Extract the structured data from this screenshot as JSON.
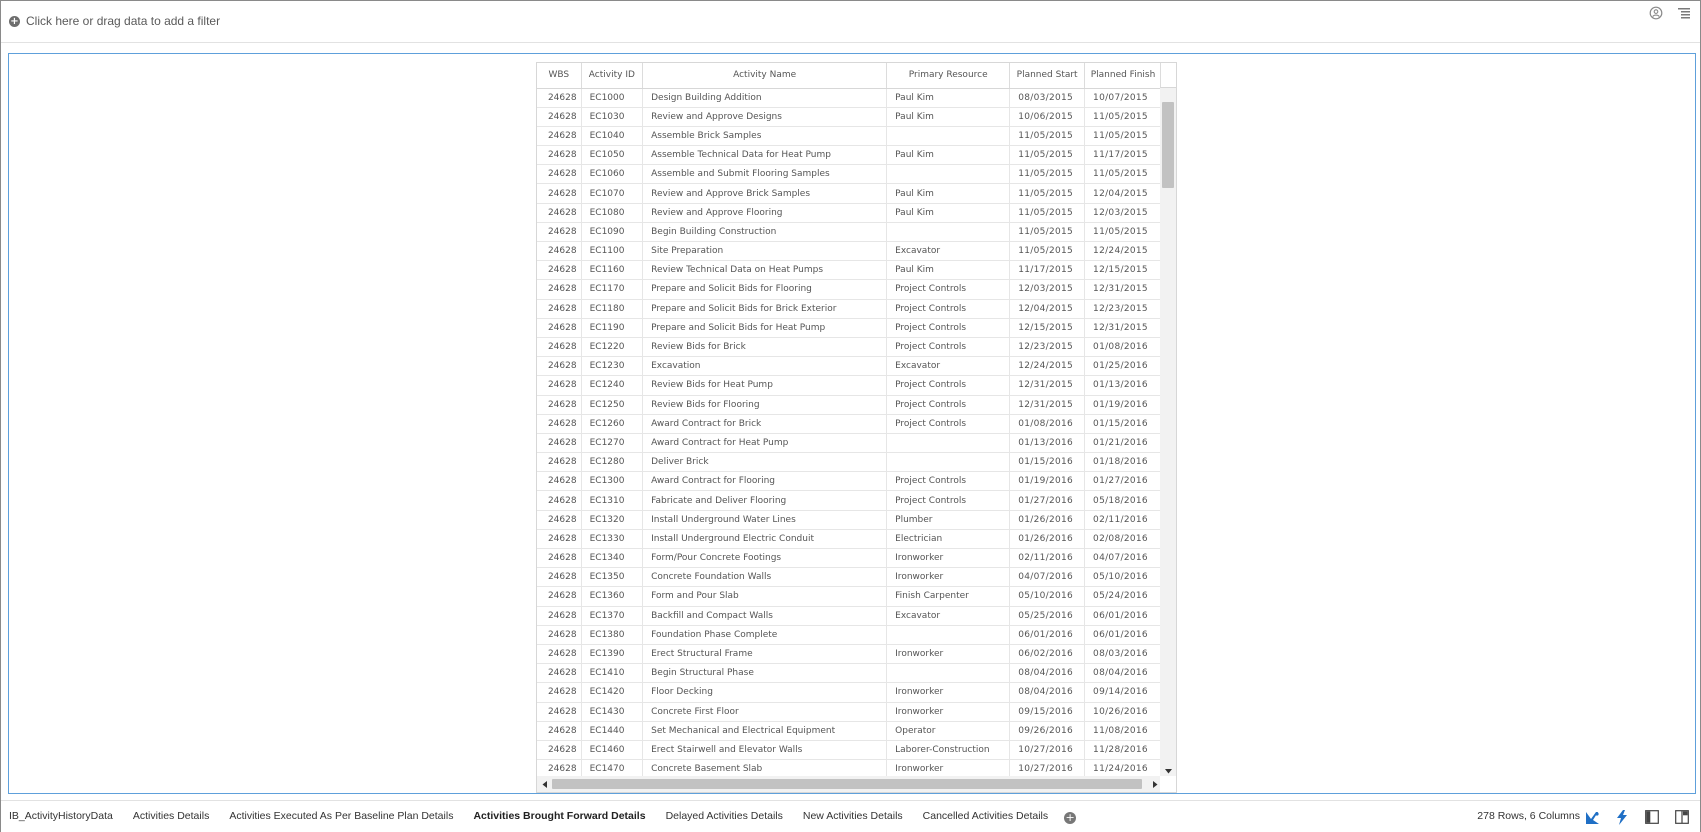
{
  "filter_bar": {
    "add_filter_text": "Click here or drag data to add a filter"
  },
  "table": {
    "columns": [
      "WBS",
      "Activity ID",
      "Activity Name",
      "Primary Resource",
      "Planned Start",
      "Planned Finish"
    ],
    "rows": [
      [
        "24628",
        "EC1000",
        "Design Building Addition",
        "Paul Kim",
        "08/03/2015",
        "10/07/2015"
      ],
      [
        "24628",
        "EC1030",
        "Review and Approve Designs",
        "Paul Kim",
        "10/06/2015",
        "11/05/2015"
      ],
      [
        "24628",
        "EC1040",
        "Assemble Brick Samples",
        "",
        "11/05/2015",
        "11/05/2015"
      ],
      [
        "24628",
        "EC1050",
        "Assemble Technical Data for Heat Pump",
        "Paul Kim",
        "11/05/2015",
        "11/17/2015"
      ],
      [
        "24628",
        "EC1060",
        "Assemble and Submit Flooring Samples",
        "",
        "11/05/2015",
        "11/05/2015"
      ],
      [
        "24628",
        "EC1070",
        "Review and Approve Brick Samples",
        "Paul Kim",
        "11/05/2015",
        "12/04/2015"
      ],
      [
        "24628",
        "EC1080",
        "Review and Approve Flooring",
        "Paul Kim",
        "11/05/2015",
        "12/03/2015"
      ],
      [
        "24628",
        "EC1090",
        "Begin Building Construction",
        "",
        "11/05/2015",
        "11/05/2015"
      ],
      [
        "24628",
        "EC1100",
        "Site Preparation",
        "Excavator",
        "11/05/2015",
        "12/24/2015"
      ],
      [
        "24628",
        "EC1160",
        "Review Technical Data on Heat Pumps",
        "Paul Kim",
        "11/17/2015",
        "12/15/2015"
      ],
      [
        "24628",
        "EC1170",
        "Prepare and Solicit Bids for Flooring",
        "Project Controls",
        "12/03/2015",
        "12/31/2015"
      ],
      [
        "24628",
        "EC1180",
        "Prepare and Solicit Bids for Brick Exterior",
        "Project Controls",
        "12/04/2015",
        "12/23/2015"
      ],
      [
        "24628",
        "EC1190",
        "Prepare and Solicit Bids for Heat Pump",
        "Project Controls",
        "12/15/2015",
        "12/31/2015"
      ],
      [
        "24628",
        "EC1220",
        "Review Bids for Brick",
        "Project Controls",
        "12/23/2015",
        "01/08/2016"
      ],
      [
        "24628",
        "EC1230",
        "Excavation",
        "Excavator",
        "12/24/2015",
        "01/25/2016"
      ],
      [
        "24628",
        "EC1240",
        "Review Bids for Heat Pump",
        "Project Controls",
        "12/31/2015",
        "01/13/2016"
      ],
      [
        "24628",
        "EC1250",
        "Review Bids for Flooring",
        "Project Controls",
        "12/31/2015",
        "01/19/2016"
      ],
      [
        "24628",
        "EC1260",
        "Award Contract for Brick",
        "Project Controls",
        "01/08/2016",
        "01/15/2016"
      ],
      [
        "24628",
        "EC1270",
        "Award Contract for Heat Pump",
        "",
        "01/13/2016",
        "01/21/2016"
      ],
      [
        "24628",
        "EC1280",
        "Deliver Brick",
        "",
        "01/15/2016",
        "01/18/2016"
      ],
      [
        "24628",
        "EC1300",
        "Award Contract for Flooring",
        "Project Controls",
        "01/19/2016",
        "01/27/2016"
      ],
      [
        "24628",
        "EC1310",
        "Fabricate and Deliver Flooring",
        "Project Controls",
        "01/27/2016",
        "05/18/2016"
      ],
      [
        "24628",
        "EC1320",
        "Install Underground Water Lines",
        "Plumber",
        "01/26/2016",
        "02/11/2016"
      ],
      [
        "24628",
        "EC1330",
        "Install Underground Electric Conduit",
        "Electrician",
        "01/26/2016",
        "02/08/2016"
      ],
      [
        "24628",
        "EC1340",
        "Form/Pour Concrete Footings",
        "Ironworker",
        "02/11/2016",
        "04/07/2016"
      ],
      [
        "24628",
        "EC1350",
        "Concrete Foundation Walls",
        "Ironworker",
        "04/07/2016",
        "05/10/2016"
      ],
      [
        "24628",
        "EC1360",
        "Form and Pour Slab",
        "Finish Carpenter",
        "05/10/2016",
        "05/24/2016"
      ],
      [
        "24628",
        "EC1370",
        "Backfill and Compact Walls",
        "Excavator",
        "05/25/2016",
        "06/01/2016"
      ],
      [
        "24628",
        "EC1380",
        "Foundation Phase Complete",
        "",
        "06/01/2016",
        "06/01/2016"
      ],
      [
        "24628",
        "EC1390",
        "Erect Structural Frame",
        "Ironworker",
        "06/02/2016",
        "08/03/2016"
      ],
      [
        "24628",
        "EC1410",
        "Begin Structural Phase",
        "",
        "08/04/2016",
        "08/04/2016"
      ],
      [
        "24628",
        "EC1420",
        "Floor Decking",
        "Ironworker",
        "08/04/2016",
        "09/14/2016"
      ],
      [
        "24628",
        "EC1430",
        "Concrete First Floor",
        "Ironworker",
        "09/15/2016",
        "10/26/2016"
      ],
      [
        "24628",
        "EC1440",
        "Set Mechanical and Electrical Equipment",
        "Operator",
        "09/26/2016",
        "11/08/2016"
      ],
      [
        "24628",
        "EC1460",
        "Erect Stairwell and Elevator Walls",
        "Laborer-Construction",
        "10/27/2016",
        "11/28/2016"
      ],
      [
        "24628",
        "EC1470",
        "Concrete Basement Slab",
        "Ironworker",
        "10/27/2016",
        "11/24/2016"
      ]
    ]
  },
  "tabs": [
    {
      "label": "IB_ActivityHistoryData",
      "active": false
    },
    {
      "label": "Activities Details",
      "active": false
    },
    {
      "label": "Activities Executed As Per Baseline Plan Details",
      "active": false
    },
    {
      "label": "Activities Brought Forward Details",
      "active": true
    },
    {
      "label": "Delayed Activities Details",
      "active": false
    },
    {
      "label": "New Activities Details",
      "active": false
    },
    {
      "label": "Cancelled Activities Details",
      "active": false
    }
  ],
  "status": {
    "text": "278 Rows, 6 Columns"
  },
  "colors": {
    "accent": "#2d6db5",
    "frame_border": "#5ea0db",
    "icon_blue": "#1f6fc5"
  },
  "icons": {
    "top": [
      "user-badge-icon",
      "list-menu-icon"
    ],
    "bottom": [
      "recommendations-icon",
      "lightning-icon",
      "panel-left-icon",
      "panel-split-icon"
    ]
  }
}
